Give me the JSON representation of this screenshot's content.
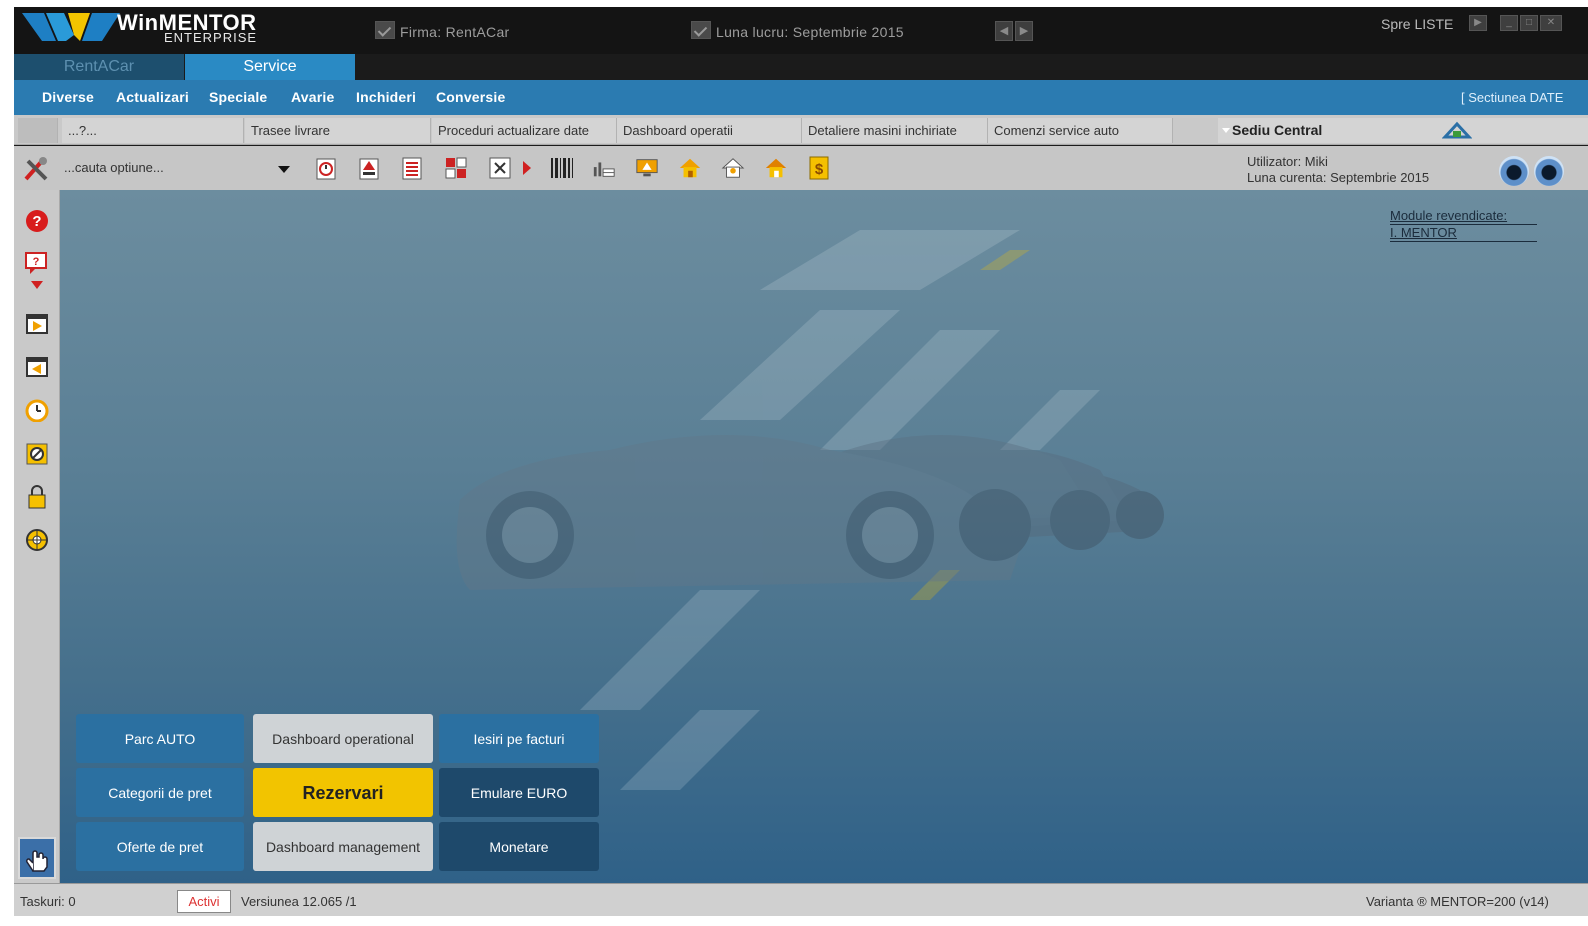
{
  "app": {
    "logo_main": "WinMENTOR",
    "logo_sub": "ENTERPRISE"
  },
  "titlebar": {
    "firma": "Firma:  RentACar",
    "luna": "Luna lucru:  Septembrie 2015",
    "spre": "Spre LISTE"
  },
  "module_tabs": [
    {
      "label": "RentACar"
    },
    {
      "label": "Service"
    }
  ],
  "menu": {
    "items": [
      "Diverse",
      "Actualizari",
      "Speciale",
      "Avarie",
      "Inchideri",
      "Conversie"
    ],
    "section_label": "[ Sectiunea DATE"
  },
  "shortcuts": {
    "items": [
      "...?...",
      "Trasee livrare",
      "Proceduri actualizare date",
      "Dashboard operatii",
      "Detaliere masini inchiriate",
      "Comenzi service auto"
    ],
    "sediu": "Sediu Central"
  },
  "toolbar": {
    "search_placeholder": "...cauta optiune...",
    "user_line1": "Utilizator: Miki",
    "user_line2": "Luna curenta: Septembrie 2015"
  },
  "modules": {
    "title": "Module  revendicate:",
    "item": "I. MENTOR"
  },
  "quick_buttons": {
    "parc_auto": "Parc AUTO",
    "dashboard_operational": "Dashboard operational",
    "iesiri_facturi": "Iesiri pe facturi",
    "categorii_pret": "Categorii de pret",
    "rezervari": "Rezervari",
    "emulare_euro": "Emulare EURO",
    "oferte_pret": "Oferte de pret",
    "dashboard_management": "Dashboard management",
    "monetare": "Monetare"
  },
  "status": {
    "taskuri": "Taskuri: 0",
    "activi": "Activi",
    "versiunea": "Versiunea 12.065 /1",
    "varianta": "Varianta ® MENTOR=200  (v14)"
  },
  "colors": {
    "accent": "#2b7bb1",
    "tab_active": "#2a8ac4",
    "highlight": "#f2c400"
  }
}
